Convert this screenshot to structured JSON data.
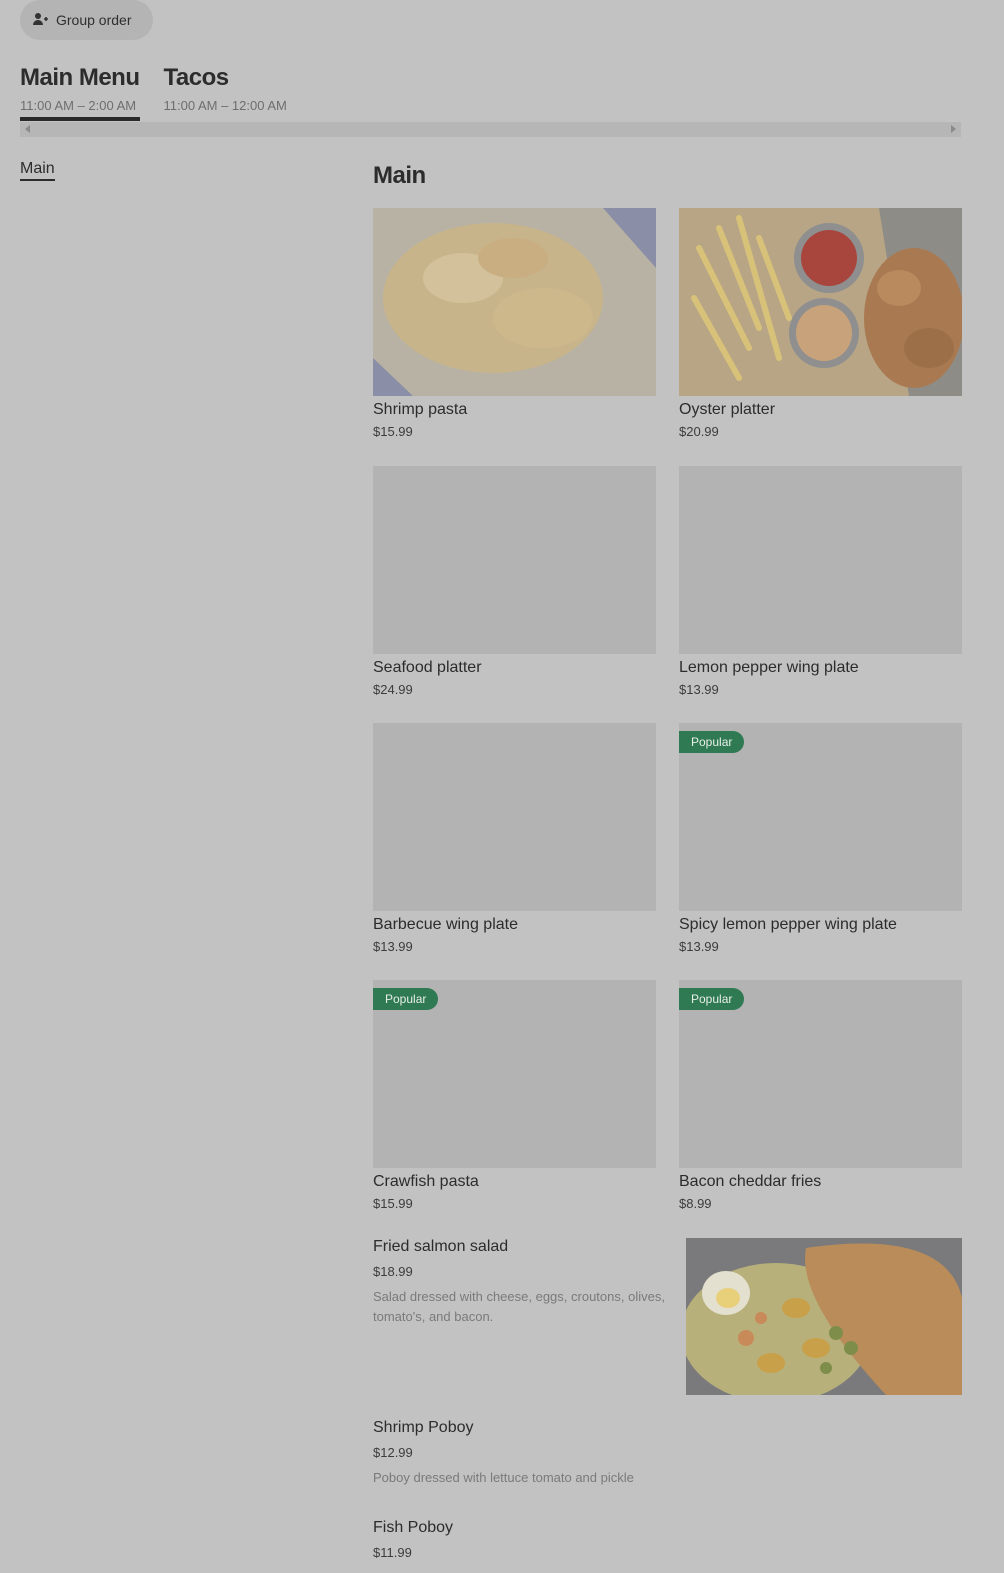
{
  "group_order": {
    "label": "Group order",
    "icon": "person-add-icon"
  },
  "menus": [
    {
      "title": "Main Menu",
      "hours": "11:00 AM – 2:00 AM",
      "active": true
    },
    {
      "title": "Tacos",
      "hours": "11:00 AM – 12:00 AM",
      "active": false
    }
  ],
  "sidebar": {
    "items": [
      {
        "label": "Main"
      }
    ]
  },
  "section": {
    "title": "Main"
  },
  "items": [
    {
      "name": "Shrimp pasta",
      "price": "$15.99"
    },
    {
      "name": "Oyster platter",
      "price": "$20.99"
    },
    {
      "name": "Seafood platter",
      "price": "$24.99"
    },
    {
      "name": "Lemon pepper wing plate",
      "price": "$13.99"
    },
    {
      "name": "Barbecue wing plate",
      "price": "$13.99"
    },
    {
      "name": "Spicy lemon pepper wing plate",
      "price": "$13.99",
      "badge": "Popular"
    },
    {
      "name": "Crawfish pasta",
      "price": "$15.99",
      "badge": "Popular"
    },
    {
      "name": "Bacon cheddar fries",
      "price": "$8.99",
      "badge": "Popular"
    }
  ],
  "list_items": [
    {
      "name": "Fried salmon salad",
      "price": "$18.99",
      "description": "Salad dressed with cheese, eggs, croutons, olives, tomato's, and bacon."
    },
    {
      "name": "Shrimp Poboy",
      "price": "$12.99",
      "description": "Poboy dressed with lettuce tomato and pickle"
    },
    {
      "name": "Fish Poboy",
      "price": "$11.99"
    }
  ],
  "colors": {
    "background": "#c2c2c2",
    "badge": "#2f7a52",
    "placeholder": "#b3b3b3"
  }
}
